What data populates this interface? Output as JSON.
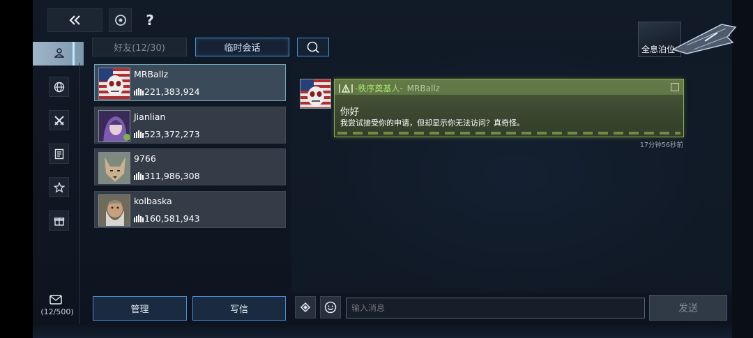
{
  "top": {
    "help_label": "?",
    "holo_label": "全息泊位"
  },
  "sidebar": {
    "items": [
      {
        "icon": "person-icon",
        "active": true
      },
      {
        "icon": "globe-icon",
        "active": false
      },
      {
        "icon": "crossed-swords-icon",
        "active": false
      },
      {
        "icon": "document-icon",
        "active": false
      },
      {
        "icon": "star-icon",
        "active": false
      },
      {
        "icon": "gift-icon",
        "active": false
      }
    ],
    "mail_count": "(12/500)"
  },
  "tabs": {
    "friends_label": "好友(12/30)",
    "temp_chat_label": "临时会话"
  },
  "friends": [
    {
      "name": "MRBallz",
      "power": "221,383,924",
      "selected": true
    },
    {
      "name": "Jianlian",
      "power": "523,372,273",
      "selected": false
    },
    {
      "name": "9766",
      "power": "311,986,308",
      "selected": false
    },
    {
      "name": "kolbaska",
      "power": "160,581,943",
      "selected": false
    }
  ],
  "chat": {
    "message": {
      "tag": "-秩序奠基人-",
      "sender": "MRBallz",
      "greeting": "你好",
      "text": "我尝试接受你的申请，但却显示你无法访问？真奇怪。",
      "timestamp": "17分钟56秒前"
    }
  },
  "footer": {
    "manage_label": "管理",
    "write_label": "写信",
    "input_placeholder": "输入消息",
    "send_label": "发送"
  },
  "colors": {
    "accent_blue": "#4a8ed8",
    "bubble_green": "#8cae4d",
    "tag_green": "#a6e06a"
  }
}
